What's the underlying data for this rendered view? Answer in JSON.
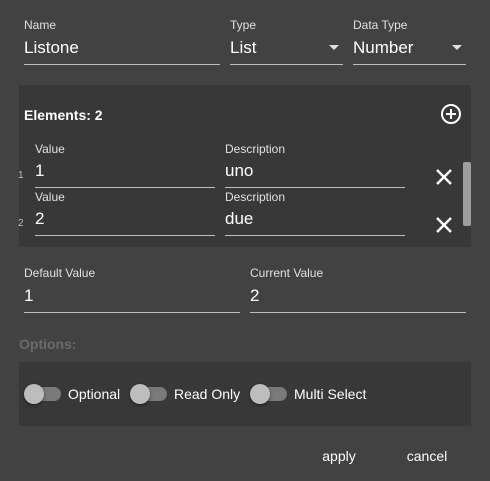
{
  "form": {
    "name": {
      "label": "Name",
      "value": "Listone"
    },
    "type": {
      "label": "Type",
      "value": "List"
    },
    "data_type": {
      "label": "Data Type",
      "value": "Number"
    }
  },
  "elements": {
    "header": "Elements: 2",
    "value_label": "Value",
    "description_label": "Description",
    "rows": [
      {
        "index": "1",
        "value": "1",
        "description": "uno"
      },
      {
        "index": "2",
        "value": "2",
        "description": "due"
      }
    ]
  },
  "default_value": {
    "label": "Default Value",
    "value": "1"
  },
  "current_value": {
    "label": "Current Value",
    "value": "2"
  },
  "options": {
    "title": "Options:",
    "optional": "Optional",
    "read_only": "Read Only",
    "multi_select": "Multi Select"
  },
  "actions": {
    "apply": "apply",
    "cancel": "cancel"
  },
  "icons": {
    "add": "add-circle-icon",
    "remove": "close-icon",
    "dropdown": "chevron-down-icon"
  }
}
